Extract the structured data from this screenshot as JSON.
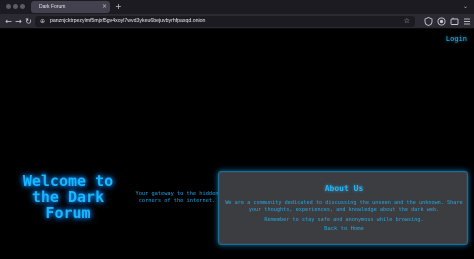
{
  "browser": {
    "tab_title": "Dark Forum",
    "tab_close": "×",
    "new_tab": "+",
    "tabs_menu": "⌄",
    "url": "panznjcktrpezylmf5mjxf5gv4xoyl7wvd3ykeu6bejuvbyrhfpasqd.onion",
    "back_glyph": "←",
    "forward_glyph": "→",
    "reload_glyph": "↻",
    "lock_glyph": "⊕",
    "bookmark_glyph": "☆"
  },
  "page": {
    "login_label": "Login",
    "welcome_heading": "Welcome to the Dark Forum",
    "tagline": "Your gateway to the hidden corners of the internet.",
    "about": {
      "title": "About Us",
      "description": "We are a community dedicated to discussing the unseen and the unknown. Share your thoughts, experiences, and knowledge about the dark web.",
      "note": "Remember to stay safe and anonymous while browsing.",
      "back_link": "Back to Home"
    }
  },
  "colors": {
    "accent": "#19b7ff",
    "background": "#000000",
    "panel": "#3b3d40"
  },
  "icons": {
    "back": "back-arrow-icon",
    "forward": "forward-arrow-icon",
    "reload": "reload-icon",
    "lock": "onion-lock-icon",
    "bookmark": "bookmark-star-icon"
  }
}
